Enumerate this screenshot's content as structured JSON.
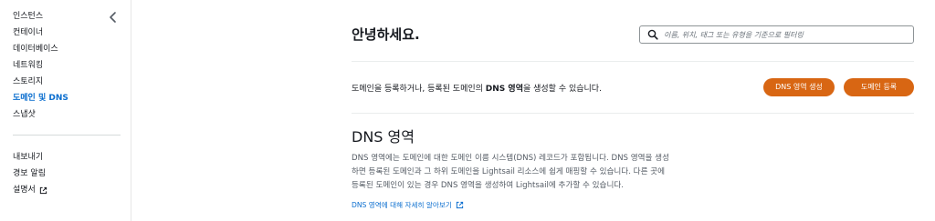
{
  "sidebar": {
    "items": [
      {
        "label": "인스턴스"
      },
      {
        "label": "컨테이너"
      },
      {
        "label": "데이터베이스"
      },
      {
        "label": "네트워킹"
      },
      {
        "label": "스토리지"
      },
      {
        "label": "도메인 및 DNS"
      },
      {
        "label": "스냅샷"
      }
    ],
    "secondary_items": [
      {
        "label": "내보내기"
      },
      {
        "label": "경보 알림"
      },
      {
        "label": "설명서"
      }
    ]
  },
  "header": {
    "title": "안녕하세요.",
    "search_placeholder": "이름, 위치, 태그 또는 유형을 기준으로 필터링"
  },
  "intro": {
    "text_before": "도메인을 등록하거나, 등록된 도메인의 ",
    "text_bold": "DNS 영역",
    "text_after": "을 생성할 수 있습니다."
  },
  "buttons": {
    "create_dns_zone": "DNS 영역 생성",
    "register_domain": "도메인 등록"
  },
  "dns_section": {
    "title": "DNS 영역",
    "description_lines": [
      "DNS 영역에는 도메인에 대한 도메인 이름 시스템(DNS) 레코드가 포함됩니다. DNS 영역을 생성",
      "하면 등록된 도메인과 그 하위 도메인을 Lightsail 리소스에 쉽게 매핑할 수 있습니다. 다른 곳에",
      "등록된 도메인이 있는 경우 DNS 영역을 생성하여 Lightsail에 추가할 수 있습니다."
    ],
    "learn_more": "DNS 영역에 대해 자세히 알아보기"
  },
  "colors": {
    "accent_button": "#d86613",
    "link": "#0b6ecf",
    "active_nav": "#0b6ecf"
  }
}
